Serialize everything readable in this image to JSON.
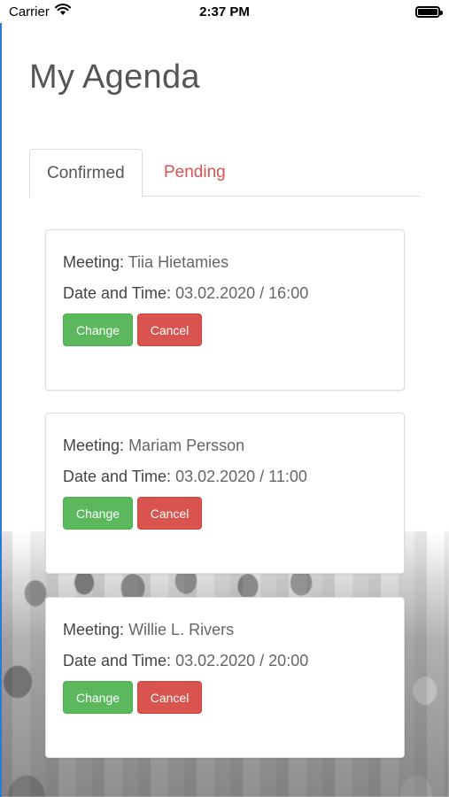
{
  "status_bar": {
    "carrier": "Carrier",
    "time": "2:37 PM",
    "battery_level": 1.0
  },
  "page": {
    "title": "My Agenda"
  },
  "tabs": [
    {
      "label": "Confirmed",
      "active": true
    },
    {
      "label": "Pending",
      "active": false
    }
  ],
  "labels": {
    "meeting": "Meeting:",
    "date_time": "Date and Time:"
  },
  "meetings": [
    {
      "name": "Tiia Hietamies",
      "date_time": "03.02.2020 / 16:00",
      "change": "Change",
      "cancel": "Cancel"
    },
    {
      "name": "Mariam Persson",
      "date_time": "03.02.2020 / 11:00",
      "change": "Change",
      "cancel": "Cancel"
    },
    {
      "name": "Willie L. Rivers",
      "date_time": "03.02.2020 / 20:00",
      "change": "Change",
      "cancel": "Cancel"
    }
  ],
  "colors": {
    "change_button": "#5cb85c",
    "cancel_button": "#d9534f",
    "pending_tab_text": "#d9534f",
    "edge_accent": "#2b7bd6"
  },
  "icons": [
    "wifi-icon",
    "battery-icon"
  ]
}
